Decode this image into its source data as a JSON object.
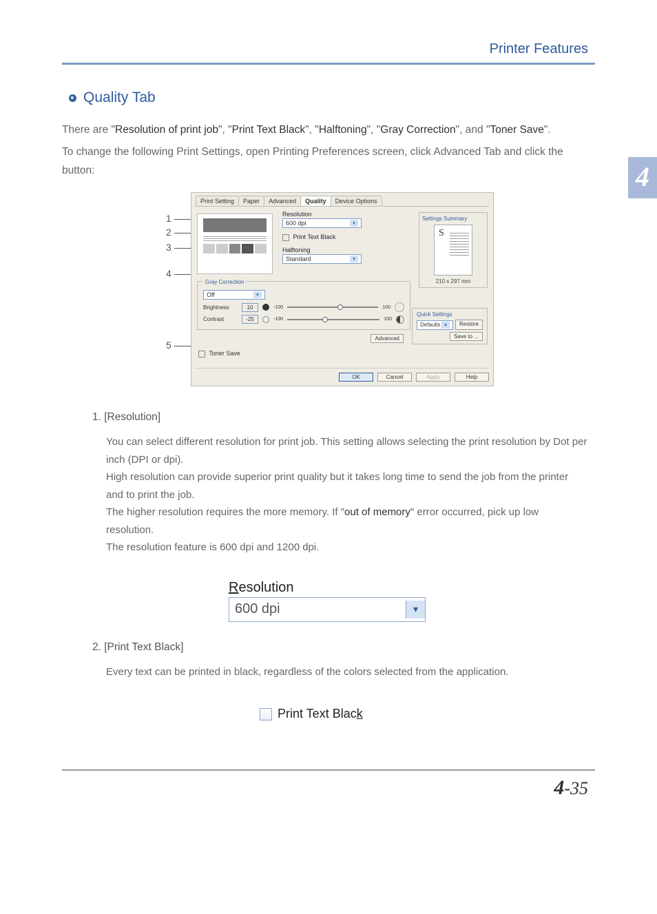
{
  "header": {
    "title": "Printer Features"
  },
  "side_tab": "4",
  "section": {
    "title": "Quality Tab",
    "intro_pre": "There are ",
    "terms": [
      "Resolution of print job",
      "Print Text Black",
      "Halftoning",
      "Gray Correction",
      "Toner Save"
    ],
    "intro_sep": ", and ",
    "intro_post": ".",
    "instruction": "To change the following Print Settings, open Printing Preferences screen, click Advanced Tab and click the button:"
  },
  "callouts": [
    "1",
    "2",
    "3",
    "4",
    "5"
  ],
  "dialog": {
    "tabs": [
      "Print Setting",
      "Paper",
      "Advanced",
      "Quality",
      "Device Options"
    ],
    "resolution_label": "Resolution",
    "resolution_value": "600 dpi",
    "print_text_black": "Print Text Black",
    "halftoning_label": "Halftoning",
    "halftoning_value": "Standard",
    "gray_correction": {
      "title": "Gray Correction",
      "mode": "Off",
      "brightness_label": "Brightness",
      "brightness_value": "10",
      "contrast_label": "Contrast",
      "contrast_value": "-25",
      "min": "-100",
      "max": "100"
    },
    "toner_save": "Toner Save",
    "settings_summary": {
      "title": "Settings Summary",
      "letter": "S",
      "dims": "210 x 297 mm"
    },
    "quick_settings": {
      "title": "Quick Settings",
      "defaults": "Defaults",
      "restore": "Restore",
      "save_to": "Save to ..."
    },
    "advanced_btn": "Advanced",
    "buttons": {
      "ok": "OK",
      "cancel": "Cancel",
      "apply": "Apply",
      "help": "Help"
    }
  },
  "items": [
    {
      "title": "1. [Resolution]",
      "p1": "You can select different resolution for print job. This setting allows selecting the print resolution by Dot per inch (DPI or dpi).",
      "p2": "High resolution can provide superior print quality but it takes long time to send the job from the printer and to print the job.",
      "p3a": "The higher resolution requires the more memory. If ",
      "p3b": "out of memory",
      "p3c": " error occurred, pick up low resolution.",
      "p4": "The resolution feature is 600 dpi and 1200 dpi."
    },
    {
      "title": "2. [Print Text Black]",
      "p1": "Every text can be printed in black, regardless of the colors selected from the application."
    }
  ],
  "res_closeup": {
    "label_pre": "R",
    "label_rest": "esolution",
    "value": "600 dpi"
  },
  "ptb_closeup": {
    "label_pre": "Print Text Blac",
    "label_u": "k"
  },
  "footer": {
    "chapter": "4",
    "sep": "-",
    "page": "35"
  }
}
